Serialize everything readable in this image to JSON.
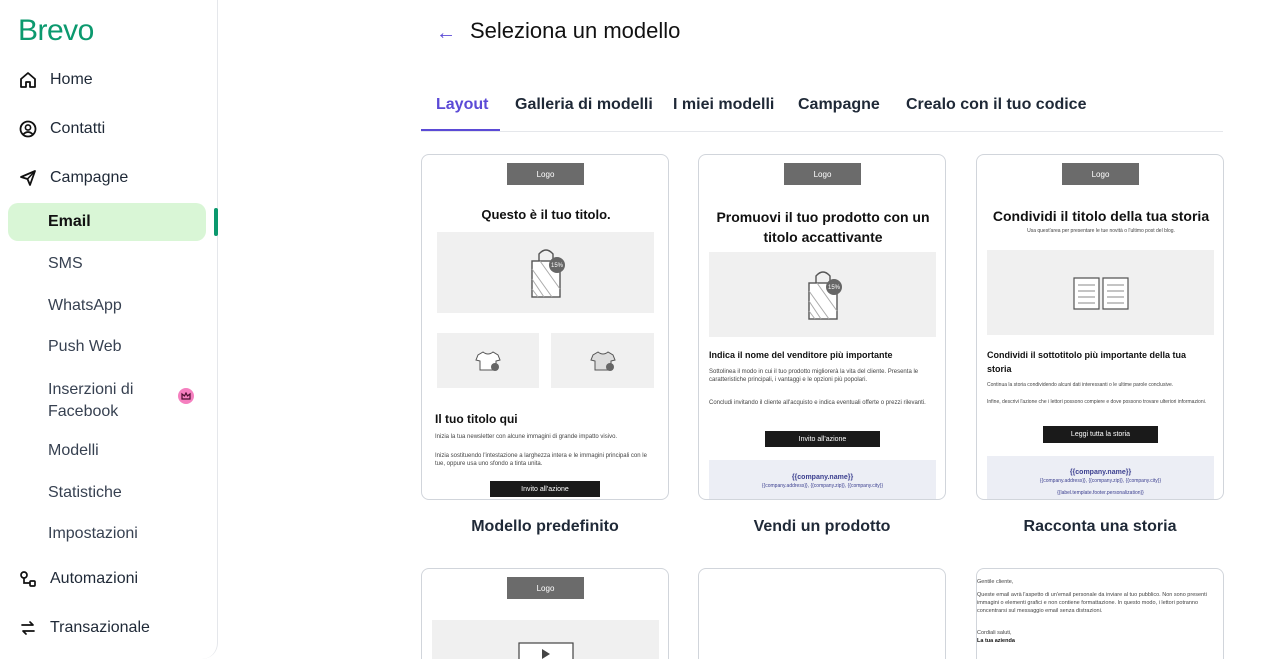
{
  "brand": "Brevo",
  "sidebar": {
    "items": [
      {
        "label": "Home",
        "icon": "home-icon"
      },
      {
        "label": "Contatti",
        "icon": "contacts-icon"
      },
      {
        "label": "Campagne",
        "icon": "send-icon"
      }
    ],
    "campaign_sub": [
      {
        "label": "Email"
      },
      {
        "label": "SMS"
      },
      {
        "label": "WhatsApp"
      },
      {
        "label": "Push Web"
      },
      {
        "label": "Inserzioni di Facebook"
      },
      {
        "label": "Modelli"
      },
      {
        "label": "Statistiche"
      },
      {
        "label": "Impostazioni"
      }
    ],
    "bottom_items": [
      {
        "label": "Automazioni",
        "icon": "automation-icon"
      },
      {
        "label": "Transazionale",
        "icon": "transactional-icon"
      }
    ]
  },
  "header": {
    "back_icon": "arrow-left-icon",
    "title": "Seleziona un modello"
  },
  "tabs": [
    {
      "label": "Layout",
      "active": true
    },
    {
      "label": "Galleria di modelli"
    },
    {
      "label": "I miei modelli"
    },
    {
      "label": "Campagne"
    },
    {
      "label": "Crealo con il tuo codice"
    }
  ],
  "templates": [
    {
      "name": "Modello predefinito",
      "logo": "Logo",
      "title": "Questo è il tuo titolo.",
      "badge": "15%",
      "section_title": "Il tuo titolo qui",
      "text1": "Inizia la tua newsletter con alcune immagini di grande impatto visivo.",
      "text2": "Inizia sostituendo l'intestazione a larghezza intera e le immagini principali con le tue, oppure usa uno sfondo a tinta unita.",
      "cta": "Invito all'azione"
    },
    {
      "name": "Vendi un prodotto",
      "logo": "Logo",
      "title": "Promuovi il tuo prodotto con un titolo accattivante",
      "badge": "15%",
      "section_title": "Indica il nome del venditore più importante",
      "text1": "Sottolinea il modo in cui il tuo prodotto migliorerà la vita del cliente. Presenta le caratteristiche principali, i vantaggi e le opzioni più popolari.",
      "text2": "Concludi invitando il cliente all'acquisto e indica eventuali offerte o prezzi rilevanti.",
      "cta": "Invito all'azione",
      "footer_name": "{{company.name}}",
      "footer_addr": "{{company.address}}, {{company.zip}}, {{company.city}}"
    },
    {
      "name": "Racconta una storia",
      "logo": "Logo",
      "title": "Condividi il titolo della tua storia",
      "subtitle": "Usa quest'area per presentare le tue novità o l'ultimo post del blog.",
      "section_title": "Condividi il sottotitolo più importante della tua storia",
      "text1": "Continua la storia condividendo alcuni dati interessanti o le ultime parole conclusive.",
      "text2": "Infine, descrivi l'azione che i lettori possono compiere e dove possono trovare ulteriori informazioni.",
      "cta": "Leggi tutta la storia",
      "footer_name": "{{company.name}}",
      "footer_addr": "{{company.address}}, {{company.zip}}, {{company.city}}",
      "footer_note": "{{label.template.footer.personalization}}"
    }
  ],
  "templates_row2": [
    {
      "logo": "Logo"
    },
    {},
    {
      "greeting": "Gentile cliente,",
      "body": "Queste email avrà l'aspetto di un'email personale da inviare al tuo pubblico. Non sono presenti immagini o elementi grafici e non contiene formattazione. In questo modo, i lettori potranno concentrarsi sul messaggio email senza distrazioni.",
      "signoff": "Cordiali saluti,",
      "company": "La tua azienda"
    }
  ]
}
